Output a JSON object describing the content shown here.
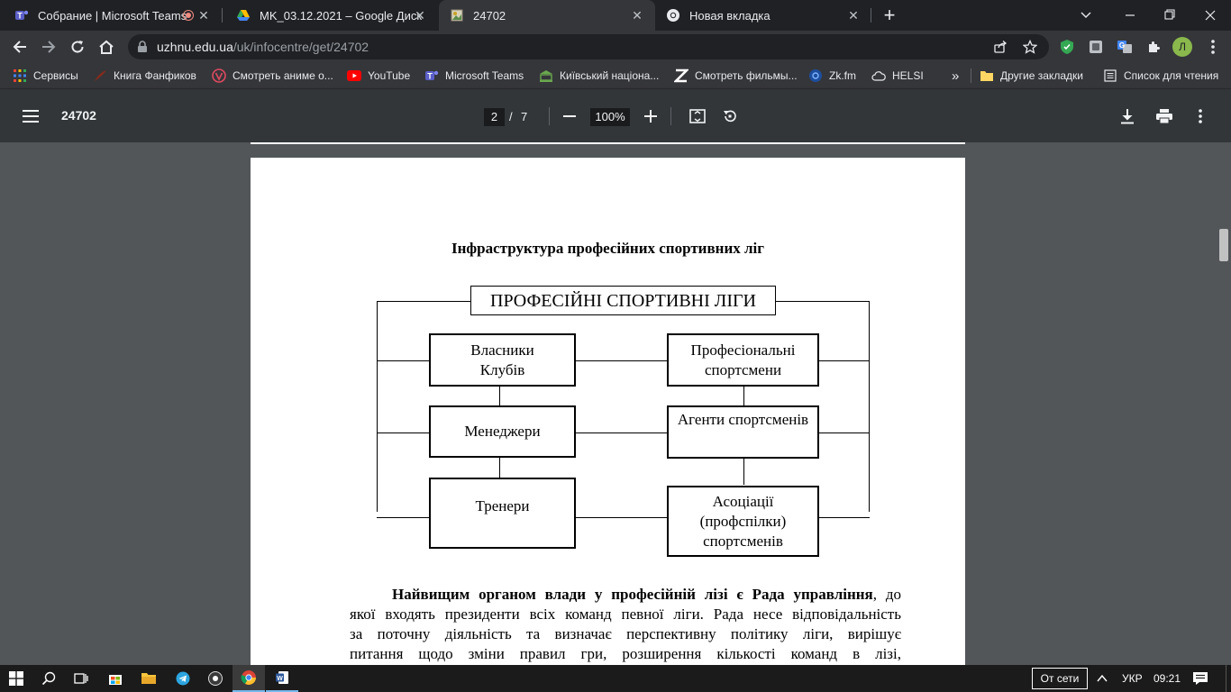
{
  "browser": {
    "tabs": [
      {
        "title": "Собрание | Microsoft Teams",
        "icon": "teams-icon",
        "recording": true
      },
      {
        "title": "MK_03.12.2021 – Google Диск",
        "icon": "google-drive-icon"
      },
      {
        "title": "24702",
        "icon": "document-icon",
        "active": true
      },
      {
        "title": "Новая вкладка",
        "icon": "chrome-icon"
      }
    ],
    "new_tab_symbol": "+",
    "url_host": "uzhnu.edu.ua",
    "url_path": "/uk/infocentre/get/24702",
    "profile_initial": "Л",
    "bookmarks": [
      {
        "label": "Сервисы",
        "icon": "apps-grid-icon"
      },
      {
        "label": "Книга Фанфиков",
        "icon": "quill-icon"
      },
      {
        "label": "Смотреть аниме о...",
        "icon": "anime-icon"
      },
      {
        "label": "YouTube",
        "icon": "youtube-icon"
      },
      {
        "label": "Microsoft Teams",
        "icon": "teams-icon"
      },
      {
        "label": "Київський націона...",
        "icon": "university-icon"
      },
      {
        "label": "Смотреть фильмы...",
        "icon": "z-logo-icon"
      },
      {
        "label": "Zk.fm",
        "icon": "zkfm-icon"
      },
      {
        "label": "HELSI",
        "icon": "cloud-icon"
      }
    ],
    "bookmarks_overflow": "»",
    "other_bookmarks": "Другие закладки",
    "reading_list": "Список для чтения"
  },
  "pdf": {
    "doc_name": "24702",
    "current_page": "2",
    "page_separator": "/",
    "total_pages": "7",
    "zoom": "100%"
  },
  "document": {
    "title": "Інфраструктура професійних спортивних ліг",
    "diagram": {
      "top": "ПРОФЕСІЙНІ СПОРТИВНІ ЛІГИ",
      "left": [
        {
          "lines": [
            "Власники",
            "Клубів"
          ]
        },
        {
          "lines": [
            "Менеджери"
          ]
        },
        {
          "lines": [
            "Тренери"
          ]
        }
      ],
      "right": [
        {
          "lines": [
            "Професіональні",
            "спортсмени"
          ]
        },
        {
          "lines": [
            "Агенти спортсменів"
          ]
        },
        {
          "lines": [
            "Асоціації",
            "(профспілки)",
            "спортсменів"
          ]
        }
      ]
    },
    "paragraph": {
      "bold_lead": "Найвищим органом влади у професійній лізі є Рада управління",
      "line1_rest": ", до",
      "lines": [
        "якої входять президенти всіх команд певної ліги. Рада несе відповідальність",
        "за поточну діяльність та визначає перспективну політику ліги, вирішує",
        "питання щодо зміни правил гри, розширення кількості команд в лізі,"
      ]
    }
  },
  "taskbar": {
    "network_status": "От сети",
    "language": "УКР",
    "time": "09:21"
  }
}
